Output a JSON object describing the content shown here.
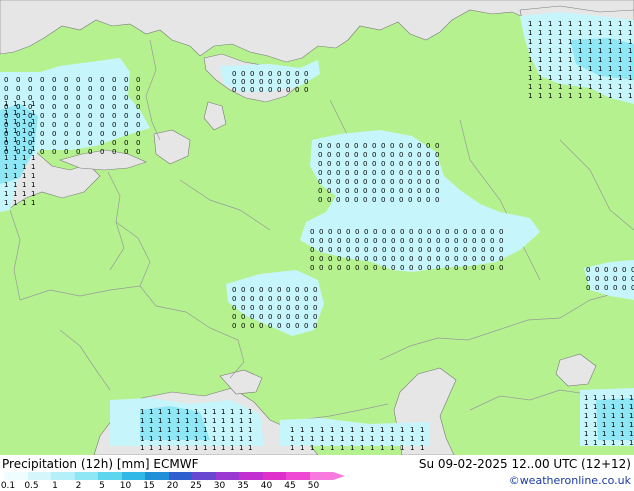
{
  "title": "Precipitation (12h) [mm] ECMWF",
  "date_text": "Su 09-02-2025 12..00 UTC (12+12)",
  "credit": "©weatheronline.co.uk",
  "colors": {
    "land": "#b5f28f",
    "sea": "#e6e6e6",
    "border": "#9a9a9a",
    "coast": "#7a7a7a",
    "precip_light": "#c6f6fb",
    "precip_mid": "#8fe6f5",
    "precip_heavy": "#4ec8ea"
  },
  "legend": {
    "labels": [
      "0.1",
      "0.5",
      "1",
      "2",
      "5",
      "10",
      "15",
      "20",
      "25",
      "30",
      "35",
      "40",
      "45",
      "50"
    ],
    "colors": [
      "#f0fdfe",
      "#d5f7fc",
      "#b5f0fa",
      "#8fe6f5",
      "#5cd5ef",
      "#32b8e6",
      "#1f8fd8",
      "#2f5fcf",
      "#6848d0",
      "#9a3ad2",
      "#c230d2",
      "#e030cc",
      "#ee48d4",
      "#f87ade"
    ]
  }
}
